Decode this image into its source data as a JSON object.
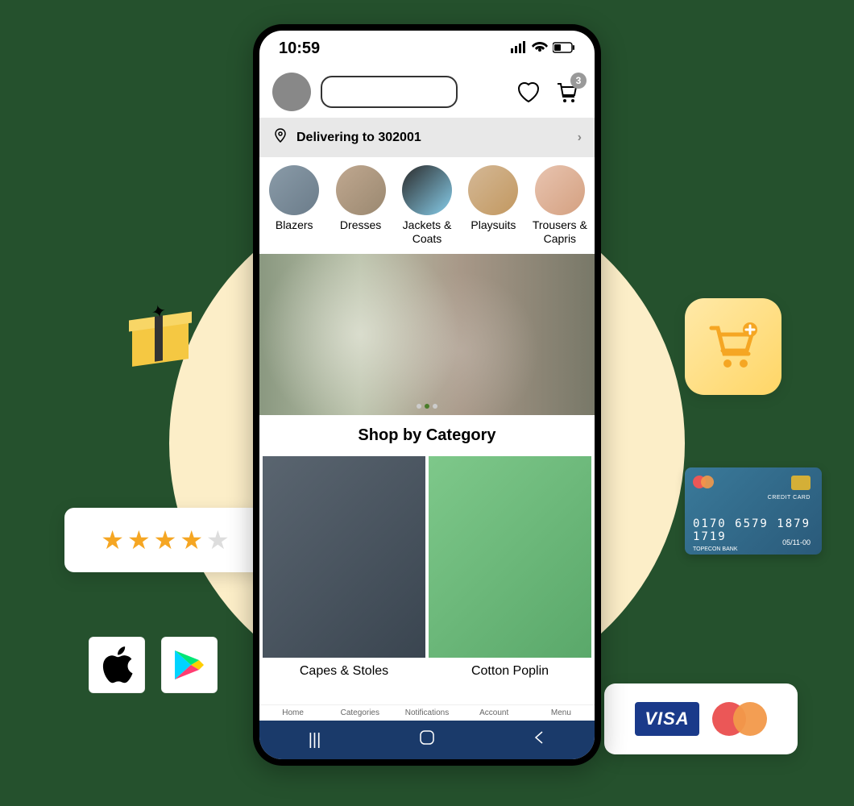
{
  "status": {
    "time": "10:59",
    "cart_count": "3"
  },
  "delivery": {
    "label": "Delivering to 302001"
  },
  "categories": [
    {
      "label": "Blazers"
    },
    {
      "label": "Dresses"
    },
    {
      "label": "Jackets & Coats"
    },
    {
      "label": "Playsuits"
    },
    {
      "label": "Trousers & Capris"
    }
  ],
  "section": {
    "title": "Shop by Category"
  },
  "shop_items": [
    {
      "label": "Capes & Stoles"
    },
    {
      "label": "Cotton Poplin"
    }
  ],
  "bottom_nav": [
    {
      "label": "Home"
    },
    {
      "label": "Categories"
    },
    {
      "label": "Notifications"
    },
    {
      "label": "Account"
    },
    {
      "label": "Menu"
    }
  ],
  "credit_card": {
    "number": "0170 6579 1879 1719",
    "expiry": "05/11-00",
    "bank": "TOPECON BANK",
    "label": "CREDIT CARD"
  },
  "payment": {
    "visa": "VISA"
  },
  "rating": {
    "stars": 4,
    "total": 5
  }
}
